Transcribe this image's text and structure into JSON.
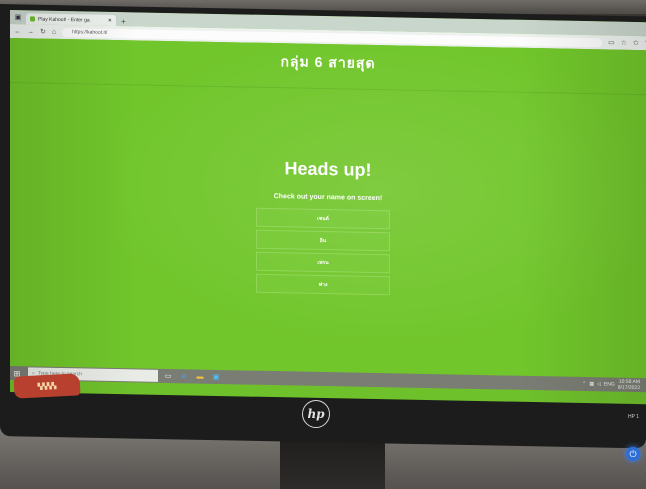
{
  "browser": {
    "tab_title": "Play Kahoot! - Enter ga",
    "new_tab_symbol": "+",
    "url": "https://kahoot.it/",
    "nav": {
      "back": "←",
      "forward": "→",
      "refresh": "↻",
      "home": "⌂"
    },
    "toolbar": {
      "reader": "▭",
      "favorite": "☆",
      "favorites_list": "✩",
      "pen": "✎",
      "share": "⇪"
    }
  },
  "page": {
    "header_title": "กลุ่ม 6 สายสุด",
    "heading": "Heads up!",
    "subtitle": "Check out your name on screen!",
    "names": [
      "เซนต์",
      "อิน",
      "เฟรน",
      "ฟาง"
    ]
  },
  "taskbar": {
    "start_icon": "⊞",
    "search_placeholder": "Type here to search",
    "time": "10:58 AM",
    "date": "8/17/2022"
  },
  "device": {
    "brand_logo": "hp",
    "model_label": "HP 1",
    "sticker_text": "sticker"
  },
  "colors": {
    "page_background": "#71c62b",
    "text": "#ffffff"
  }
}
